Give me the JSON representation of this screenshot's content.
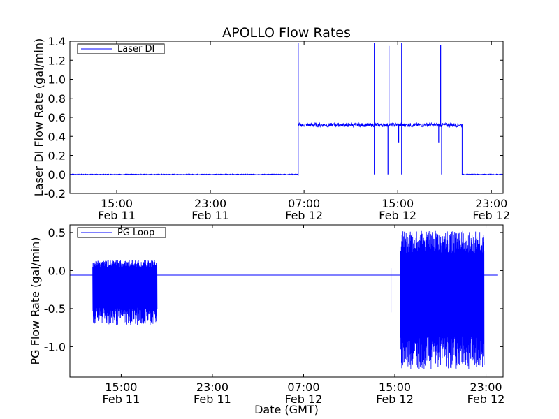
{
  "chart_data": [
    {
      "type": "line",
      "title": "APOLLO Flow Rates",
      "xlabel": "",
      "ylabel": "Laser DI Flow Rate (gal/min)",
      "ylim": [
        -0.2,
        1.4
      ],
      "y_ticks": [
        "-0.2",
        "0.0",
        "0.2",
        "0.4",
        "0.6",
        "0.8",
        "1.0",
        "1.2",
        "1.4"
      ],
      "x_ticks": [
        {
          "line1": "15:00",
          "line2": "Feb 11"
        },
        {
          "line1": "23:00",
          "line2": "Feb 11"
        },
        {
          "line1": "07:00",
          "line2": "Feb 12"
        },
        {
          "line1": "15:00",
          "line2": "Feb 12"
        },
        {
          "line1": "23:00",
          "line2": "Feb 12"
        }
      ],
      "legend": "top-left",
      "series": [
        {
          "name": "Laser DI",
          "color": "#0000ff",
          "x_range": [
            "2012-02-11 11:00",
            "2012-02-13 00:00"
          ],
          "x_start": "2012-02-11 11:00",
          "x_end": "2012-02-13 00:00",
          "segments": [
            {
              "from": "2012-02-11 11:00",
              "to": "2012-02-12 06:30",
              "level": 0.0,
              "noise": 0.004
            },
            {
              "from": "2012-02-12 06:30",
              "to": "2012-02-12 20:30",
              "level": 0.52,
              "noise": 0.02
            },
            {
              "from": "2012-02-12 20:30",
              "to": "2012-02-13 00:00",
              "level": 0.0,
              "noise": 0.004
            }
          ],
          "spikes": [
            {
              "at": "2012-02-12 06:30",
              "value": 1.38
            },
            {
              "at": "2012-02-12 13:00",
              "value": 0.0
            },
            {
              "at": "2012-02-12 13:00",
              "value": 1.38
            },
            {
              "at": "2012-02-12 14:10",
              "value": 0.0
            },
            {
              "at": "2012-02-12 14:15",
              "value": 1.35
            },
            {
              "at": "2012-02-12 15:20",
              "value": 0.0
            },
            {
              "at": "2012-02-12 15:20",
              "value": 1.38
            },
            {
              "at": "2012-02-12 18:40",
              "value": 1.36
            },
            {
              "at": "2012-02-12 18:45",
              "value": 0.0
            },
            {
              "at": "2012-02-12 15:05",
              "value": 0.33
            },
            {
              "at": "2012-02-12 18:30",
              "value": 0.33
            }
          ]
        }
      ]
    },
    {
      "type": "line",
      "title": "",
      "xlabel": "Date (GMT)",
      "ylabel": "PG Flow Rate (gal/min)",
      "ylim": [
        -1.4,
        0.6
      ],
      "y_ticks": [
        "-1.0",
        "-0.5",
        "0.0",
        "0.5"
      ],
      "x_ticks": [
        {
          "line1": "15:00",
          "line2": "Feb 11"
        },
        {
          "line1": "23:00",
          "line2": "Feb 11"
        },
        {
          "line1": "07:00",
          "line2": "Feb 12"
        },
        {
          "line1": "15:00",
          "line2": "Feb 12"
        },
        {
          "line1": "23:00",
          "line2": "Feb 12"
        }
      ],
      "legend": "top-left",
      "series": [
        {
          "name": "PG Loop",
          "color": "#0000ff",
          "x_start": "2012-02-11 10:30",
          "x_end": "2012-02-12 24:00",
          "baseline": -0.06,
          "oscillating_segments": [
            {
              "from": "2012-02-11 12:30",
              "to": "2012-02-11 18:10",
              "min": -0.72,
              "max": 0.14
            },
            {
              "from": "2012-02-12 15:30",
              "to": "2012-02-12 22:50",
              "min": -1.3,
              "max": 0.52
            }
          ],
          "spikes": [
            {
              "at": "2012-02-12 14:40",
              "value": 0.03
            },
            {
              "at": "2012-02-12 14:40",
              "value": -0.55
            }
          ]
        }
      ]
    }
  ]
}
